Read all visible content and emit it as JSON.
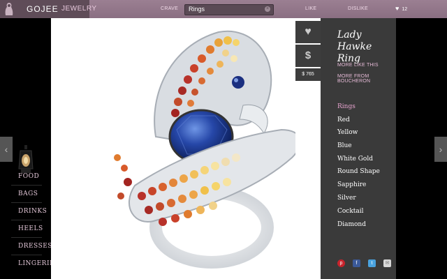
{
  "header": {
    "brand": "GOJEE",
    "section": "JEWELRY",
    "nav": {
      "crave": "CRAVE",
      "like": "LIKE",
      "dislike": "DISLIKE"
    },
    "search": {
      "value": "Rings",
      "clear_icon": "close-icon"
    },
    "likes_count": "12"
  },
  "sidebar": {
    "items": [
      {
        "label": "FOOD"
      },
      {
        "label": "BAGS"
      },
      {
        "label": "DRINKS"
      },
      {
        "label": "HEELS"
      },
      {
        "label": "DRESSES"
      },
      {
        "label": "LINGERIE"
      }
    ]
  },
  "actions": {
    "like_icon": "heart-icon",
    "buy_symbol": "$",
    "price": "$ 765"
  },
  "product": {
    "title": "Lady Hawke Ring",
    "more_like_this": "MORE LIKE THIS",
    "more_from": "MORE FROM BOUCHERON",
    "tags": [
      "Rings",
      "Red",
      "Yellow",
      "Blue",
      "White Gold",
      "Round Shape",
      "Sapphire",
      "Silver",
      "Cocktail",
      "Diamond"
    ],
    "active_tag": "Rings"
  },
  "share": {
    "icons": [
      "pinterest-icon",
      "facebook-icon",
      "twitter-icon",
      "email-icon"
    ]
  },
  "colors": {
    "topbar": "#8a6f82",
    "accent_pink": "#e7a3cf",
    "panel": "#3a3a3a",
    "sapphire": "#1e3f9a"
  }
}
